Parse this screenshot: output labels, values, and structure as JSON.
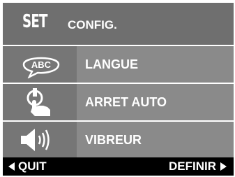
{
  "header": {
    "set_label": "SET",
    "title": "CONFIG."
  },
  "menu": {
    "items": [
      {
        "label": "LANGUE",
        "icon": "speech-bubble-abc-icon",
        "icon_text": "ABC"
      },
      {
        "label": "ARRET AUTO",
        "icon": "hand-power-icon"
      },
      {
        "label": "VIBREUR",
        "icon": "speaker-vibration-icon"
      }
    ]
  },
  "footer": {
    "left": "QUIT",
    "right": "DEFINIR"
  },
  "colors": {
    "screen": "#8a8a8a",
    "header": "#6f6f6f",
    "icon_box": "#767676",
    "footer": "#000000",
    "text": "#ffffff"
  }
}
